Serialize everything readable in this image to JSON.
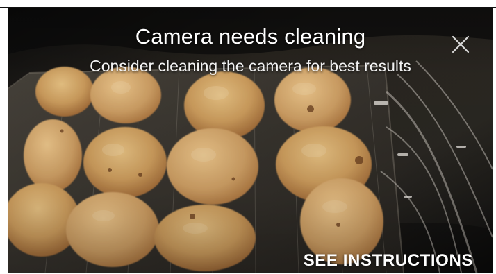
{
  "dialog": {
    "title": "Camera needs cleaning",
    "subtitle": "Consider cleaning the camera for best results",
    "action_label": "SEE INSTRUCTIONS",
    "close_icon": "close-icon"
  },
  "colors": {
    "text": "#ffffff",
    "subtext": "#f1f1f1",
    "frame": "#111111"
  }
}
